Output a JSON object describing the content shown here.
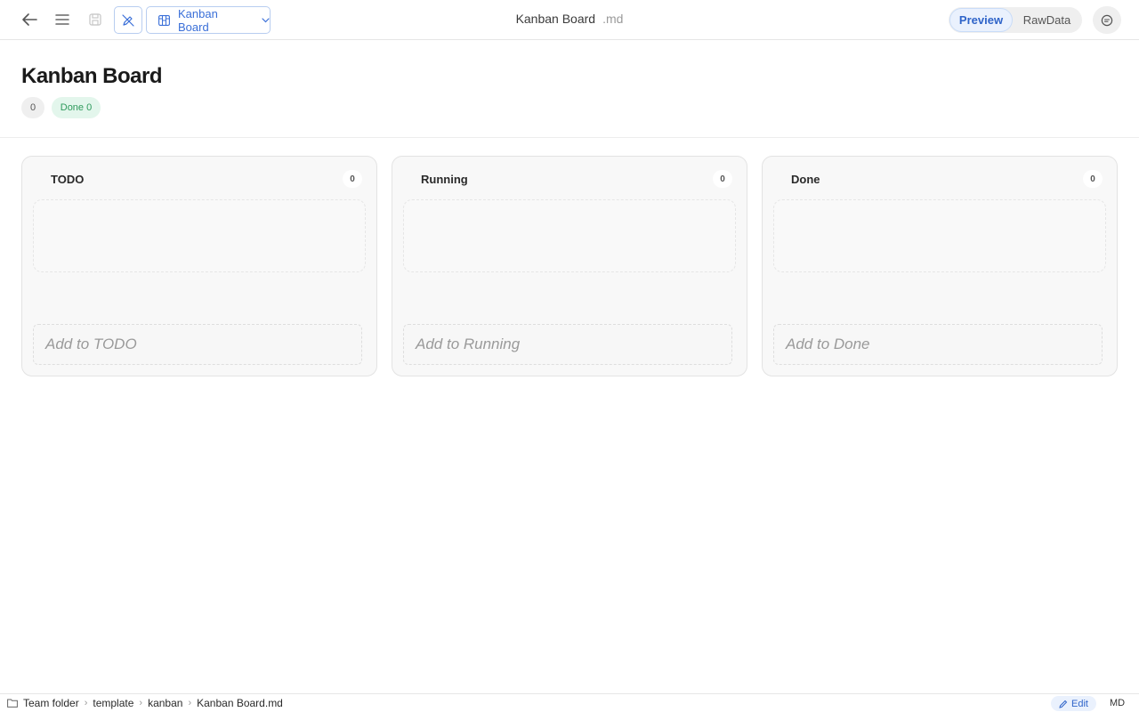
{
  "toolbar": {
    "view_select_label": "Kanban Board",
    "document_title": "Kanban Board",
    "document_ext": ".md",
    "preview_label": "Preview",
    "rawdata_label": "RawData"
  },
  "header": {
    "title": "Kanban Board",
    "total_badge": "0",
    "done_badge": "Done 0"
  },
  "columns": [
    {
      "title": "TODO",
      "count": "0",
      "add_placeholder": "Add to TODO"
    },
    {
      "title": "Running",
      "count": "0",
      "add_placeholder": "Add to Running"
    },
    {
      "title": "Done",
      "count": "0",
      "add_placeholder": "Add to Done"
    }
  ],
  "statusbar": {
    "breadcrumbs": [
      "Team folder",
      "template",
      "kanban",
      "Kanban Board.md"
    ],
    "edit_label": "Edit",
    "format_label": "MD"
  },
  "icons": {
    "back": "arrow-left-icon",
    "menu": "hamburger-icon",
    "save": "save-icon",
    "tool": "pen-off-icon",
    "board": "kanban-icon",
    "chat": "comment-icon",
    "folder": "folder-icon",
    "edit": "pencil-icon"
  },
  "colors": {
    "accent": "#2f64c9",
    "done_badge_bg": "#e3f6ec",
    "done_badge_text": "#2e9a5c"
  }
}
